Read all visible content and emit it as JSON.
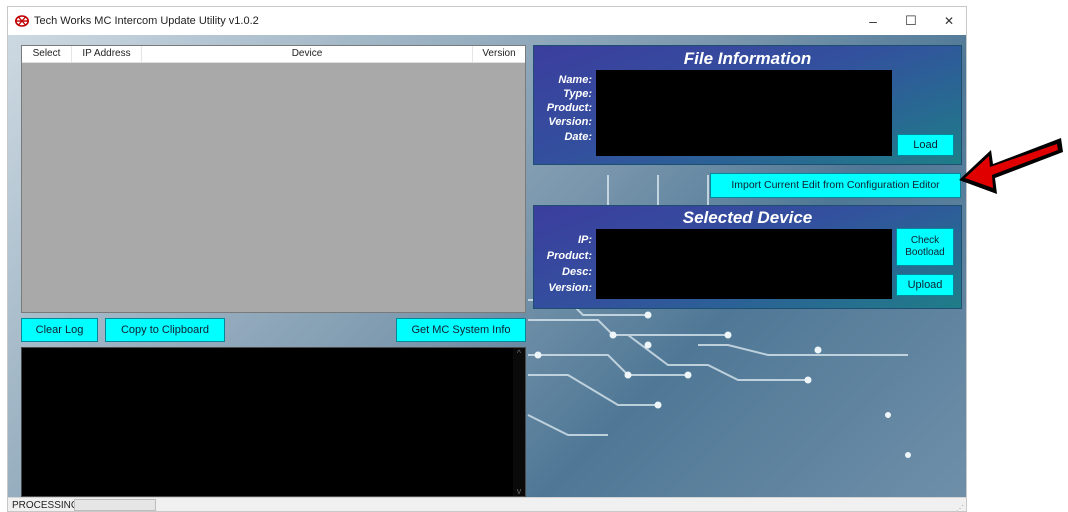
{
  "window": {
    "title": "Tech Works MC Intercom Update Utility v1.0.2",
    "minimize_glyph": "–",
    "maximize_glyph": "☐",
    "close_glyph": "✕"
  },
  "device_list": {
    "columns": [
      "Select",
      "IP Address",
      "Device",
      "Version"
    ]
  },
  "buttons": {
    "clear_log": "Clear Log",
    "copy_clipboard": "Copy to Clipboard",
    "get_system_info": "Get MC System Info",
    "load": "Load",
    "import_edit": "Import Current Edit from Configuration Editor",
    "check_bootload_line1": "Check",
    "check_bootload_line2": "Bootload",
    "upload": "Upload"
  },
  "file_info": {
    "title": "File Information",
    "labels": [
      "Name:",
      "Type:",
      "Product:",
      "Version:",
      "Date:"
    ]
  },
  "selected_device": {
    "title": "Selected Device",
    "labels": [
      "IP:",
      "Product:",
      "Desc:",
      "Version:"
    ]
  },
  "log_scrollbar": {
    "up_glyph": "^",
    "down_glyph": "v"
  },
  "status": {
    "text": "PROCESSING",
    "progress": 0
  },
  "colors": {
    "button": "#00ffff",
    "panel_start": "#3b3e9e",
    "panel_end": "#1f7d88",
    "annotation_arrow": "#e00000",
    "progress_fill": "#06b025"
  },
  "icons": {
    "app": "tech-works-logo-icon",
    "annotation": "red-arrow-icon"
  }
}
